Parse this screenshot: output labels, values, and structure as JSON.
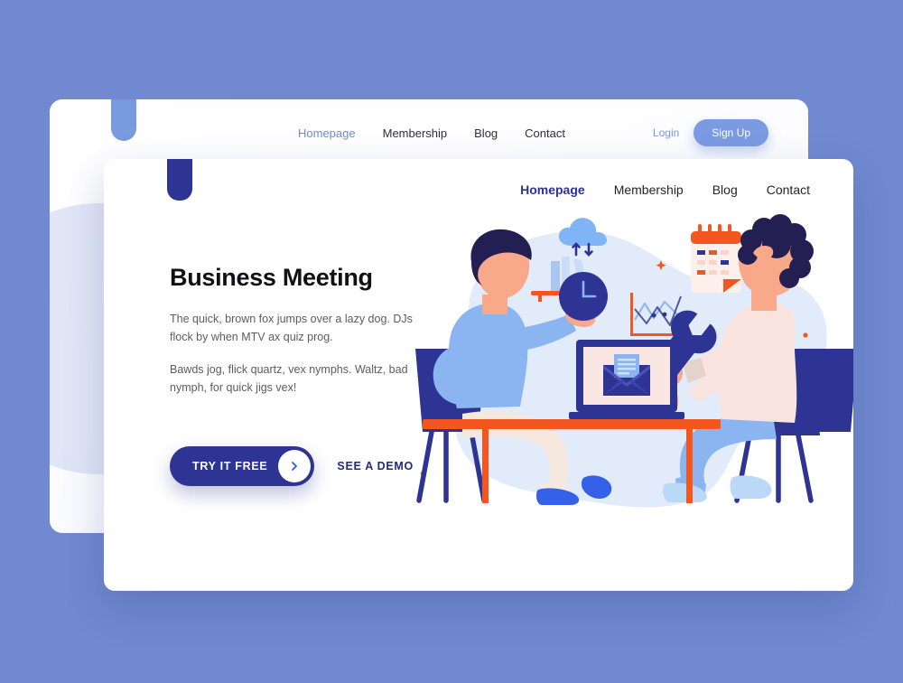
{
  "page": {
    "background_color": "#7089d0"
  },
  "back_card": {
    "logo_icon": "logo-mark",
    "nav": [
      {
        "label": "Homepage",
        "active": true
      },
      {
        "label": "Membership",
        "active": false
      },
      {
        "label": "Blog",
        "active": false
      },
      {
        "label": "Contact",
        "active": false
      }
    ],
    "login_label": "Login",
    "signup_label": "Sign Up",
    "accent_color": "#7b9ae2"
  },
  "front_card": {
    "logo_icon": "logo-mark",
    "nav": [
      {
        "label": "Homepage",
        "active": true
      },
      {
        "label": "Membership",
        "active": false
      },
      {
        "label": "Blog",
        "active": false
      },
      {
        "label": "Contact",
        "active": false
      }
    ],
    "hero": {
      "title": "Business Meeting",
      "paragraph_1": "The quick, brown fox jumps over a lazy dog. DJs flock by when MTV ax quiz prog.",
      "paragraph_2": "Bawds jog, flick quartz, vex nymphs. Waltz, bad nymph, for quick jigs vex!"
    },
    "cta": {
      "primary_label": "TRY IT FREE",
      "primary_icon": "chevron-right-icon",
      "secondary_label": "SEE A DEMO"
    },
    "accent_color": "#2d3494",
    "illustration": {
      "name": "business-meeting-illustration",
      "description": "Two people seated at an orange table with a laptop",
      "elements": [
        "bookshelf-icon",
        "cloud-sync-icon",
        "clock-icon",
        "laptop-email-icon",
        "line-chart-icon",
        "calendar-icon",
        "wrench-icon",
        "person-left",
        "person-right",
        "table",
        "chair-left",
        "chair-right"
      ],
      "colors": {
        "orange": "#f4561f",
        "navy": "#2d3494",
        "light_blue": "#7fa9ef",
        "pale_blue": "#e4ecfa",
        "skin": "#f7a98a",
        "cream": "#f7e6dc"
      }
    }
  }
}
